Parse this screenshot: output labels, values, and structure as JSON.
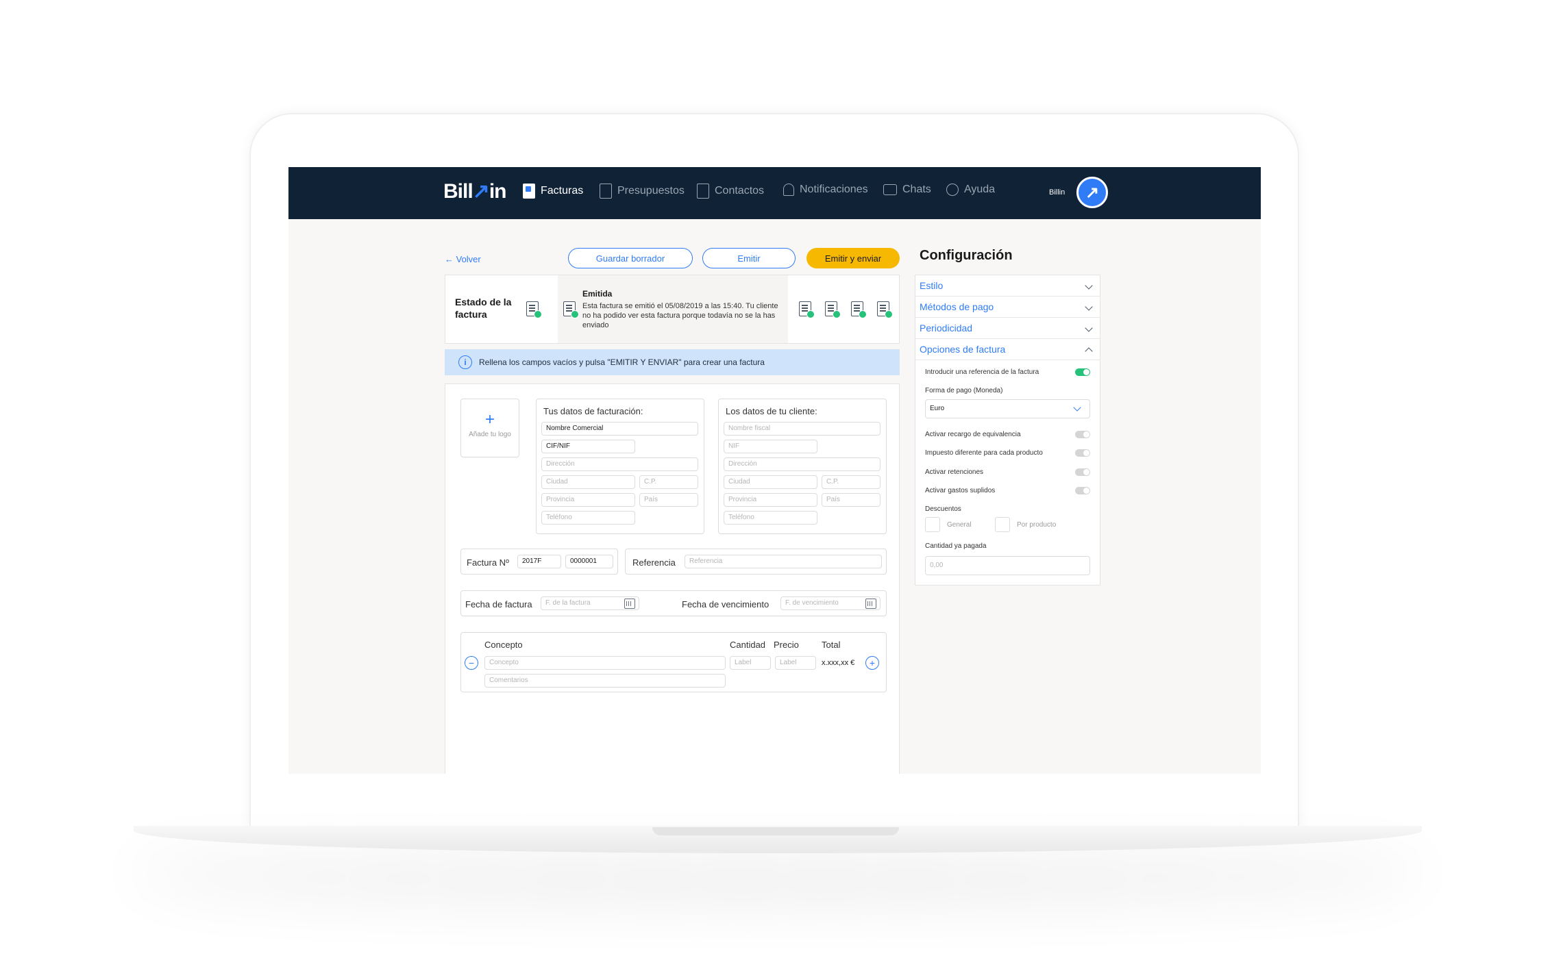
{
  "brand": {
    "name": "Billin",
    "accent": "#2f7cf6",
    "nav_bg": "#0f2236",
    "warn": "#f6b800",
    "success": "#27c27a"
  },
  "nav": {
    "items": [
      {
        "label": "Facturas",
        "icon": "invoice-icon",
        "active": true
      },
      {
        "label": "Presupuestos",
        "icon": "budget-icon"
      },
      {
        "label": "Contactos",
        "icon": "contacts-icon"
      },
      {
        "label": "Notificaciones",
        "icon": "bell-icon"
      },
      {
        "label": "Chats",
        "icon": "chat-icon"
      },
      {
        "label": "Ayuda",
        "icon": "help-icon"
      }
    ],
    "user_name": "Billin",
    "avatar_glyph": "↗"
  },
  "toolbar": {
    "back": "← Volver",
    "save_draft": "Guardar borrador",
    "emit": "Emitir",
    "emit_send": "Emitir y enviar"
  },
  "status": {
    "label": "Estado de la factura",
    "title": "Emitida",
    "description": "Esta factura se emitió el 05/08/2019 a las 15:40. Tu cliente no ha podido ver esta factura porque todavía no se la has enviado"
  },
  "info": {
    "icon": "info-icon",
    "glyph": "i",
    "text": "Rellena los campos vacíos y pulsa \"EMITIR Y ENVIAR\" para crear una factura"
  },
  "logo_upload": {
    "plus": "+",
    "label": "Añade tu logo"
  },
  "billing": {
    "title": "Tus datos de facturación:",
    "commercial_name": "Nombre Comercial",
    "cif": "CIF/NIF",
    "address": "Dirección",
    "city": "Ciudad",
    "zip": "C.P.",
    "province": "Provincia",
    "country": "País",
    "phone": "Teléfono"
  },
  "client": {
    "title": "Los datos de tu cliente:",
    "fiscal_name": "Nombre fiscal",
    "nif": "NIF",
    "address": "Dirección",
    "city": "Ciudad",
    "zip": "C.P.",
    "province": "Provincia",
    "country": "País",
    "phone": "Teléfono"
  },
  "invoice": {
    "number_label": "Factura Nº",
    "series": "2017F",
    "number": "0000001",
    "reference_label": "Referencia",
    "reference_placeholder": "Referencia",
    "date_label": "Fecha de factura",
    "date_placeholder": "F. de la factura",
    "due_label": "Fecha de vencimiento",
    "due_placeholder": "F. de vencimiento"
  },
  "lines": {
    "headers": {
      "concept": "Concepto",
      "quantity": "Cantidad",
      "price": "Precio",
      "total": "Total"
    },
    "concept_placeholder": "Concepto",
    "comments_placeholder": "Comentarios",
    "qty_placeholder": "Label",
    "price_placeholder": "Label",
    "total_value": "x.xxx,xx €",
    "minus": "−",
    "plus": "+"
  },
  "config": {
    "title": "Configuración",
    "sections": [
      "Estilo",
      "Métodos de pago",
      "Periodicidad",
      "Opciones de factura"
    ],
    "options": {
      "reference": "Introducir una referencia de la factura",
      "payment_form": "Forma de pago (Moneda)",
      "currency": "Euro",
      "surcharge": "Activar recargo de equivalencia",
      "tax_per_product": "Impuesto diferente para cada producto",
      "retentions": "Activar retenciones",
      "expenses": "Activar gastos suplidos",
      "discounts": "Descuentos",
      "discount_general": "General",
      "discount_product": "Por producto",
      "paid_amount": "Cantidad ya pagada",
      "paid_value": "0,00"
    }
  }
}
